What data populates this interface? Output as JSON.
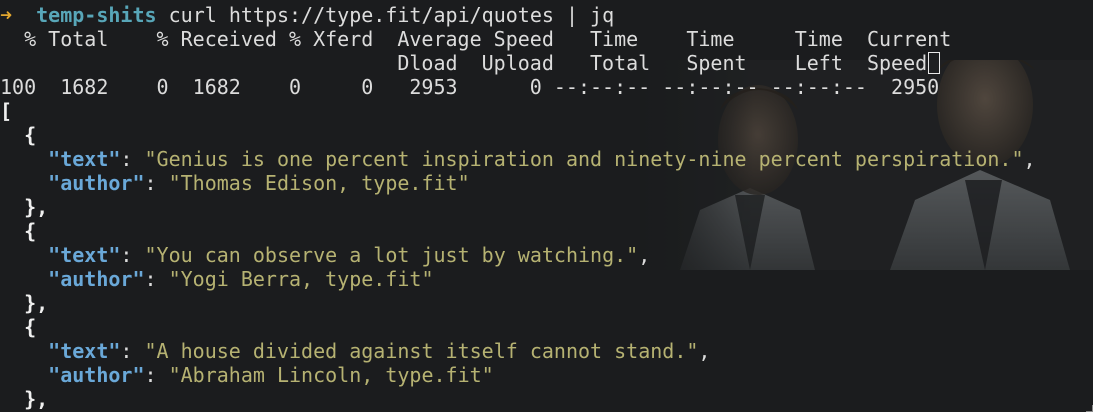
{
  "prompt": {
    "arrow": "➜",
    "directory": "temp-shits",
    "command": "curl https://type.fit/api/quotes | jq"
  },
  "curl_progress": {
    "header1": "  % Total    % Received % Xferd  Average Speed   Time    Time     Time  Current",
    "header2": "                                 Dload  Upload   Total   Spent    Left  Speed",
    "row": "100  1682    0  1682    0     0   2953      0 --:--:-- --:--:-- --:--:--  2950"
  },
  "json_output": {
    "open_bracket": "[",
    "open_brace": "{",
    "close_brace": "},",
    "text_key": "\"text\"",
    "author_key": "\"author\"",
    "quotes": [
      {
        "text": "\"Genius is one percent inspiration and ninety-nine percent perspiration.\"",
        "author": "\"Thomas Edison, type.fit\""
      },
      {
        "text": "\"You can observe a lot just by watching.\"",
        "author": "\"Yogi Berra, type.fit\""
      },
      {
        "text": "\"A house divided against itself cannot stand.\"",
        "author": "\"Abraham Lincoln, type.fit\""
      }
    ]
  },
  "colors": {
    "background": "#1b1c1e",
    "prompt_arrow": "#e3a72f",
    "directory": "#58a6b8",
    "json_key": "#6aa8d8",
    "json_string": "#b6b272"
  },
  "icons": {
    "cursor": "block-cursor-outline",
    "background": "wallpaper-portrait-photo"
  }
}
